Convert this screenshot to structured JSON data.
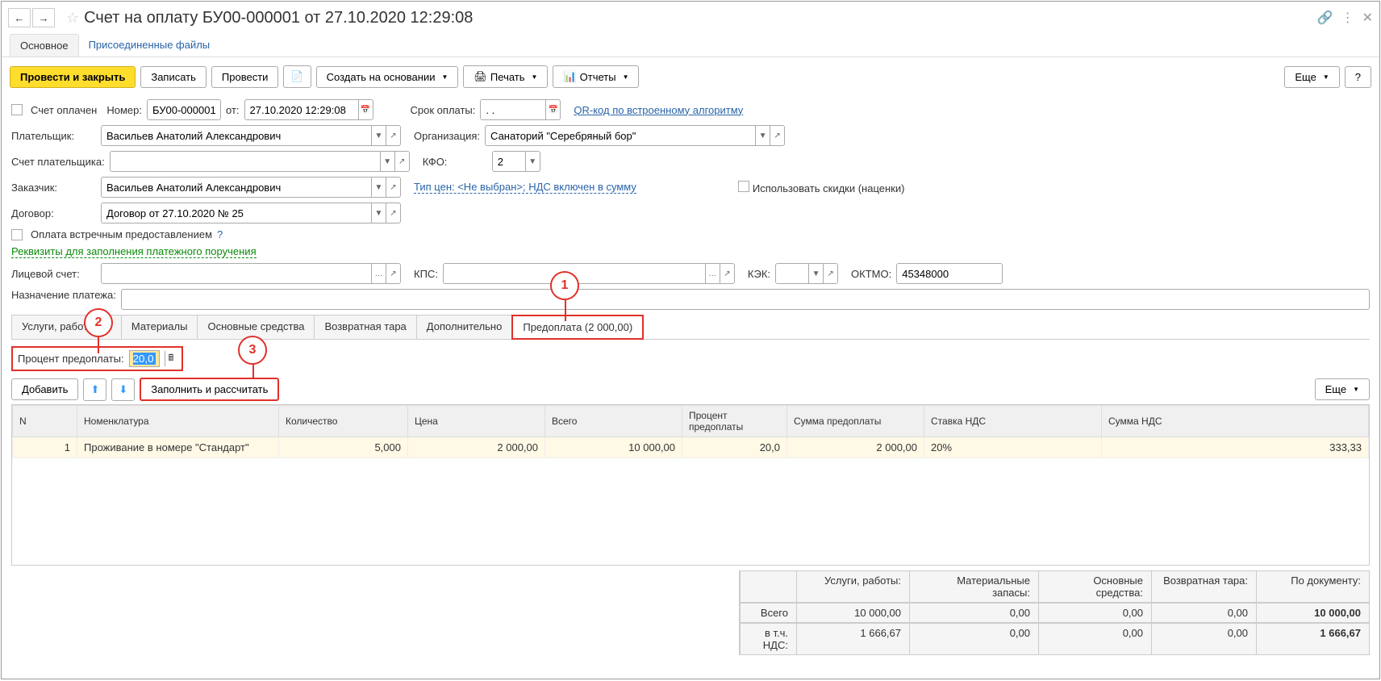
{
  "title": "Счет на оплату БУ00-000001 от 27.10.2020 12:29:08",
  "top_tabs": {
    "main": "Основное",
    "attached": "Присоединенные файлы"
  },
  "toolbar": {
    "submit_close": "Провести и закрыть",
    "save": "Записать",
    "submit": "Провести",
    "create_based": "Создать на основании",
    "print": "Печать",
    "reports": "Отчеты",
    "more": "Еще",
    "help": "?"
  },
  "form": {
    "paid_label": "Счет оплачен",
    "number_label": "Номер:",
    "number_value": "БУ00-000001",
    "from_label": "от:",
    "date_value": "27.10.2020 12:29:08",
    "due_label": "Срок оплаты:",
    "due_value": ". .",
    "qr_link": "QR-код по встроенному алгоритму",
    "payer_label": "Плательщик:",
    "payer_value": "Васильев Анатолий Александрович",
    "org_label": "Организация:",
    "org_value": "Санаторий \"Серебряный бор\"",
    "payer_acc_label": "Счет плательщика:",
    "kfo_label": "КФО:",
    "kfo_value": "2",
    "customer_label": "Заказчик:",
    "customer_value": "Васильев Анатолий Александрович",
    "price_type_link": "Тип цен: <Не выбран>; НДС включен в сумму",
    "use_discounts_label": "Использовать скидки (наценки)",
    "contract_label": "Договор:",
    "contract_value": "Договор от 27.10.2020 № 25",
    "counter_pay_label": "Оплата встречным предоставлением",
    "req_link": "Реквизиты для заполнения платежного поручения",
    "acc_label": "Лицевой счет:",
    "kps_label": "КПС:",
    "kek_label": "КЭК:",
    "oktmo_label": "ОКТМО:",
    "oktmo_value": "45348000",
    "purpose_label": "Назначение платежа:"
  },
  "tabs": {
    "services": "Услуги, работы (1)",
    "materials": "Материалы",
    "assets": "Основные средства",
    "tare": "Возвратная тара",
    "extra": "Дополнительно",
    "prepay": "Предоплата (2 000,00)"
  },
  "prepay": {
    "percent_label": "Процент предоплаты:",
    "percent_value": "20,0"
  },
  "table_toolbar": {
    "add": "Добавить",
    "fill_calc": "Заполнить и рассчитать",
    "more": "Еще"
  },
  "columns": {
    "n": "N",
    "nom": "Номенклатура",
    "qty": "Количество",
    "price": "Цена",
    "total": "Всего",
    "prepay_pct": "Процент предоплаты",
    "prepay_sum": "Сумма предоплаты",
    "vat_rate": "Ставка НДС",
    "vat_sum": "Сумма НДС"
  },
  "rows": [
    {
      "n": "1",
      "nom": "Проживание в номере \"Стандарт\"",
      "qty": "5,000",
      "price": "2 000,00",
      "total": "10 000,00",
      "prepay_pct": "20,0",
      "prepay_sum": "2 000,00",
      "vat_rate": "20%",
      "vat_sum": "333,33"
    }
  ],
  "totals": {
    "hdr_services": "Услуги, работы:",
    "hdr_materials": "Материальные запасы:",
    "hdr_assets": "Основные средства:",
    "hdr_tare": "Возвратная тара:",
    "hdr_doc": "По документу:",
    "row_total": "Всего",
    "row_vat": "в т.ч. НДС:",
    "services_total": "10 000,00",
    "services_vat": "1 666,67",
    "materials_total": "0,00",
    "materials_vat": "0,00",
    "assets_total": "0,00",
    "assets_vat": "0,00",
    "tare_total": "0,00",
    "tare_vat": "0,00",
    "doc_total": "10 000,00",
    "doc_vat": "1 666,67"
  },
  "callouts": {
    "c1": "1",
    "c2": "2",
    "c3": "3"
  }
}
